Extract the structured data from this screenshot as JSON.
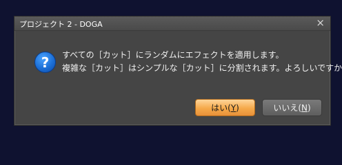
{
  "window": {
    "title": "プロジェクト 2 - DOGA",
    "close_glyph": "×"
  },
  "icon": {
    "name": "question-icon",
    "glyph": "?"
  },
  "message": {
    "line1": "すべての［カット］にランダムにエフェクトを適用します。",
    "line2": "複雑な［カット］はシンプルな［カット］に分割されます。よろしいですか？"
  },
  "buttons": {
    "yes": {
      "text": "はい(",
      "mnemonic": "Y",
      "suffix": ")"
    },
    "no": {
      "text": "いいえ(",
      "mnemonic": "N",
      "suffix": ")"
    }
  }
}
